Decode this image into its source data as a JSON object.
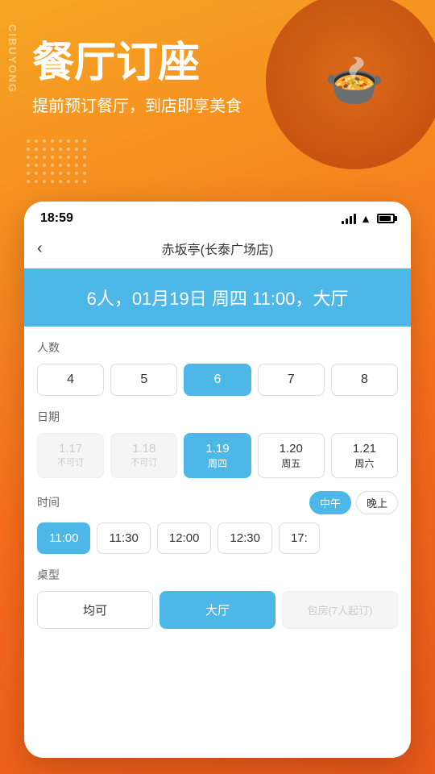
{
  "app": {
    "background_color": "#f5a623",
    "vertical_label": "CIBUYONG"
  },
  "header": {
    "title": "餐厅订座",
    "subtitle": "提前预订餐厅，到店即享美食"
  },
  "status_bar": {
    "time": "18:59",
    "signal": "full",
    "wifi": true,
    "battery_pct": 75
  },
  "nav": {
    "back_label": "‹",
    "title": "赤坂亭(长泰广场店)"
  },
  "summary": {
    "text": "6人，01月19日 周四 11:00，大厅"
  },
  "sections": {
    "people_label": "人数",
    "people_options": [
      {
        "value": "4",
        "selected": false,
        "disabled": false
      },
      {
        "value": "5",
        "selected": false,
        "disabled": false
      },
      {
        "value": "6",
        "selected": true,
        "disabled": false
      },
      {
        "value": "7",
        "selected": false,
        "disabled": false
      },
      {
        "value": "8",
        "selected": false,
        "disabled": false
      }
    ],
    "date_label": "日期",
    "date_options": [
      {
        "num": "1.17",
        "day": "",
        "note": "不可订",
        "selected": false,
        "disabled": true
      },
      {
        "num": "1.18",
        "day": "",
        "note": "不可订",
        "selected": false,
        "disabled": true
      },
      {
        "num": "1.19",
        "day": "周四",
        "note": "",
        "selected": true,
        "disabled": false
      },
      {
        "num": "1.20",
        "day": "周五",
        "note": "",
        "selected": false,
        "disabled": false
      },
      {
        "num": "1.21",
        "day": "周六",
        "note": "",
        "selected": false,
        "disabled": false
      }
    ],
    "time_label": "时间",
    "time_filters": [
      {
        "label": "中午",
        "selected": true
      },
      {
        "label": "晚上",
        "selected": false
      }
    ],
    "time_options": [
      {
        "value": "11:00",
        "selected": true
      },
      {
        "value": "11:30",
        "selected": false
      },
      {
        "value": "12:00",
        "selected": false
      },
      {
        "value": "12:30",
        "selected": false
      },
      {
        "value": "17:",
        "selected": false
      }
    ],
    "table_label": "桌型",
    "table_options": [
      {
        "value": "均可",
        "selected": false,
        "disabled": false
      },
      {
        "value": "大厅",
        "selected": true,
        "disabled": false
      },
      {
        "value": "包房(7人起订)",
        "selected": false,
        "disabled": true
      }
    ]
  }
}
